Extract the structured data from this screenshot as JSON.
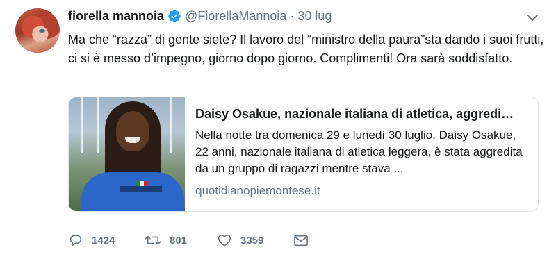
{
  "tweet": {
    "author": {
      "name": "fiorella mannoia",
      "handle": "@FiorellaMannoia",
      "separator": "·",
      "time": "30 lug",
      "verified": true
    },
    "text": "Ma che “razza” di gente siete? Il lavoro del “ministro della paura”sta dando i suoi frutti, ci si è messo d’impegno, giorno dopo giorno. Complimenti! Ora sarà soddisfatto.",
    "card": {
      "title": "Daisy Osakue, nazionale italiana di atletica, aggredi…",
      "description": "Nella notte tra domenica 29 e lunedì 30 luglio, Daisy Osakue, 22 anni, nazionale italiana di atletica leggera, è stata aggredita da un gruppo di ragazzi mentre stava ...",
      "domain": "quotidianopiemontese.it"
    },
    "actions": {
      "replies": "1424",
      "retweets": "801",
      "likes": "3359"
    }
  },
  "icons": {
    "verified": "verified-badge-icon",
    "caret": "chevron-down-icon",
    "reply": "reply-icon",
    "retweet": "retweet-icon",
    "like": "heart-icon",
    "dm": "envelope-icon"
  },
  "colors": {
    "text": "#14171a",
    "secondary": "#657786",
    "verified": "#1da1f2",
    "border": "#e1e8ed"
  }
}
